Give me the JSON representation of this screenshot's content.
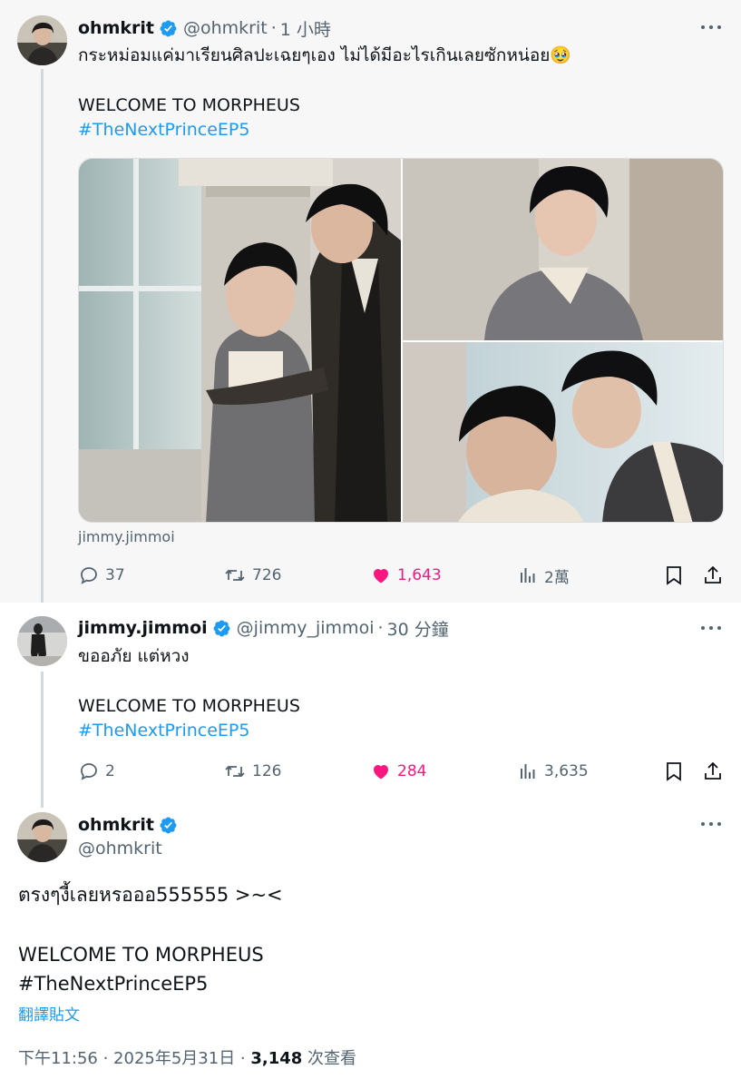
{
  "tweets": [
    {
      "name": "ohmkrit",
      "handle": "@ohmkrit",
      "sep": "·",
      "time": "1 小時",
      "text": "กระหม่อมแค่มาเรียนศิลปะเฉยๆเอง ไม่ได้มีอะไรเกินเลยซักหน่อย🥹",
      "line2": "WELCOME TO MORPHEUS",
      "hashtag": "#TheNextPrinceEP5",
      "media_credit": "jimmy.jimmoi",
      "replies": "37",
      "reposts": "726",
      "likes": "1,643",
      "views": "2萬"
    },
    {
      "name": "jimmy.jimmoi",
      "handle": "@jimmy_jimmoi",
      "sep": "·",
      "time": "30 分鐘",
      "text": "ขออภัย แต่หวง",
      "line2": "WELCOME TO MORPHEUS",
      "hashtag": "#TheNextPrinceEP5",
      "replies": "2",
      "reposts": "126",
      "likes": "284",
      "views": "3,635"
    }
  ],
  "focus": {
    "name": "ohmkrit",
    "handle": "@ohmkrit",
    "text": "ตรงๆงี้เลยหรอออ555555 >~<",
    "line2": "WELCOME TO MORPHEUS",
    "hashtag": "#TheNextPrinceEP5",
    "translate": "翻譯貼文",
    "timestamp": "下午11:56 · 2025年5月31日 · ",
    "view_count": "3,148",
    "view_label": " 次查看"
  },
  "icons": [
    "verified-badge-icon",
    "more-icon",
    "reply-icon",
    "repost-icon",
    "like-icon",
    "views-icon",
    "bookmark-icon",
    "share-icon"
  ],
  "colors": {
    "link": "#1d9bf0",
    "like": "#f91880",
    "secondary": "#536471",
    "verified": "#1d9bf0"
  }
}
